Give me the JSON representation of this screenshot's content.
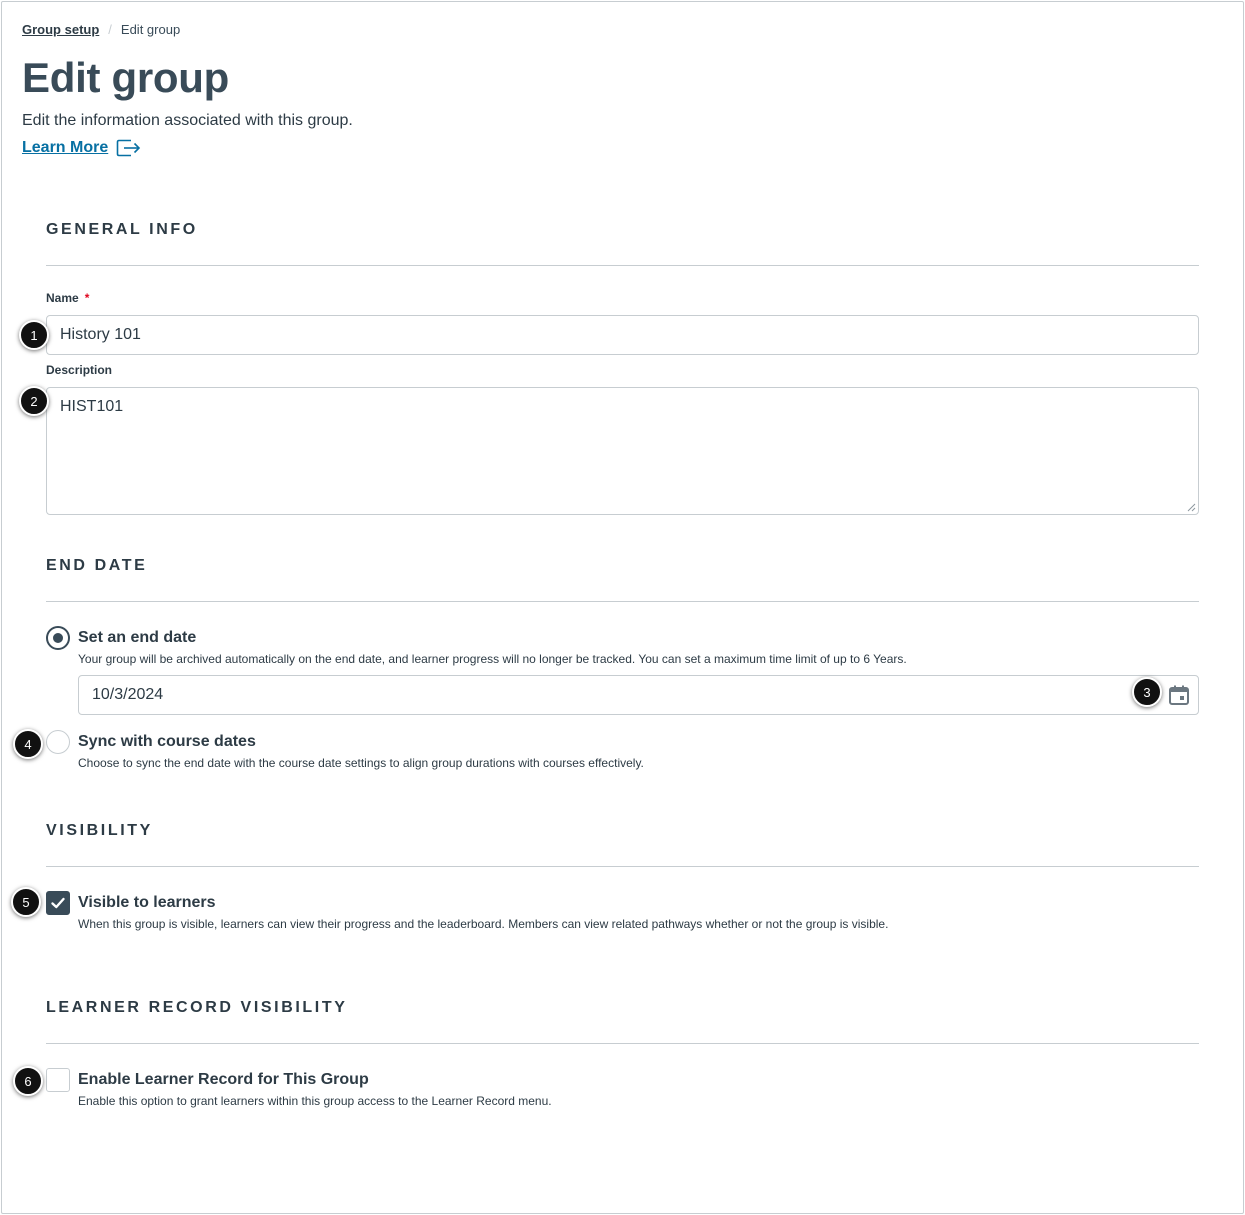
{
  "breadcrumb": {
    "parent": "Group setup",
    "separator": "/",
    "current": "Edit group"
  },
  "header": {
    "title": "Edit group",
    "subtitle": "Edit the information associated with this group.",
    "learn_more": "Learn More"
  },
  "general_info": {
    "heading": "GENERAL INFO",
    "name_label": "Name",
    "required_marker": "*",
    "name_value": "History 101",
    "description_label": "Description",
    "description_value": "HIST101"
  },
  "end_date": {
    "heading": "END DATE",
    "set_end_date": {
      "title": "Set an end date",
      "desc": "Your group will be archived automatically on the end date, and learner progress will no longer be tracked. You can set a maximum time limit of up to 6 Years.",
      "selected": true
    },
    "date_value": "10/3/2024",
    "sync": {
      "title": "Sync with course dates",
      "desc": "Choose to sync the end date with the course date settings to align group durations with courses effectively.",
      "selected": false
    }
  },
  "visibility": {
    "heading": "VISIBILITY",
    "visible": {
      "title": "Visible to learners",
      "desc": "When this group is visible, learners can view their progress and the leaderboard. Members can view related pathways whether or not the group is visible.",
      "checked": true
    }
  },
  "learner_record": {
    "heading": "LEARNER RECORD VISIBILITY",
    "enable": {
      "title": "Enable Learner Record for This Group",
      "desc": "Enable this option to grant learners within this group access to the Learner Record menu.",
      "checked": false
    }
  },
  "callouts": [
    "1",
    "2",
    "3",
    "4",
    "5",
    "6"
  ],
  "icons": {
    "learn_more": "external-link-icon",
    "date": "calendar-icon",
    "check": "checkmark-icon"
  },
  "colors": {
    "link": "#0770a3",
    "text": "#2d3b45",
    "heading": "#394b58",
    "border": "#c7cdd1",
    "required": "#e0061f"
  }
}
